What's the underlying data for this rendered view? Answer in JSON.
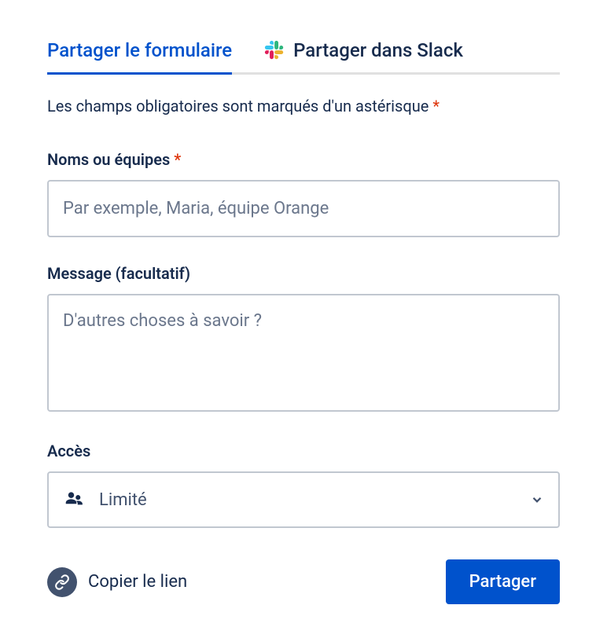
{
  "tabs": {
    "share_form": "Partager le formulaire",
    "share_slack": "Partager dans Slack"
  },
  "helper_text": "Les champs obligatoires sont marqués d'un astérisque",
  "fields": {
    "names": {
      "label": "Noms ou équipes",
      "placeholder": "Par exemple, Maria, équipe Orange",
      "value": ""
    },
    "message": {
      "label": "Message (facultatif)",
      "placeholder": "D'autres choses à savoir ?",
      "value": ""
    },
    "access": {
      "label": "Accès",
      "value": "Limité"
    }
  },
  "footer": {
    "copy_link": "Copier le lien",
    "share_button": "Partager"
  }
}
